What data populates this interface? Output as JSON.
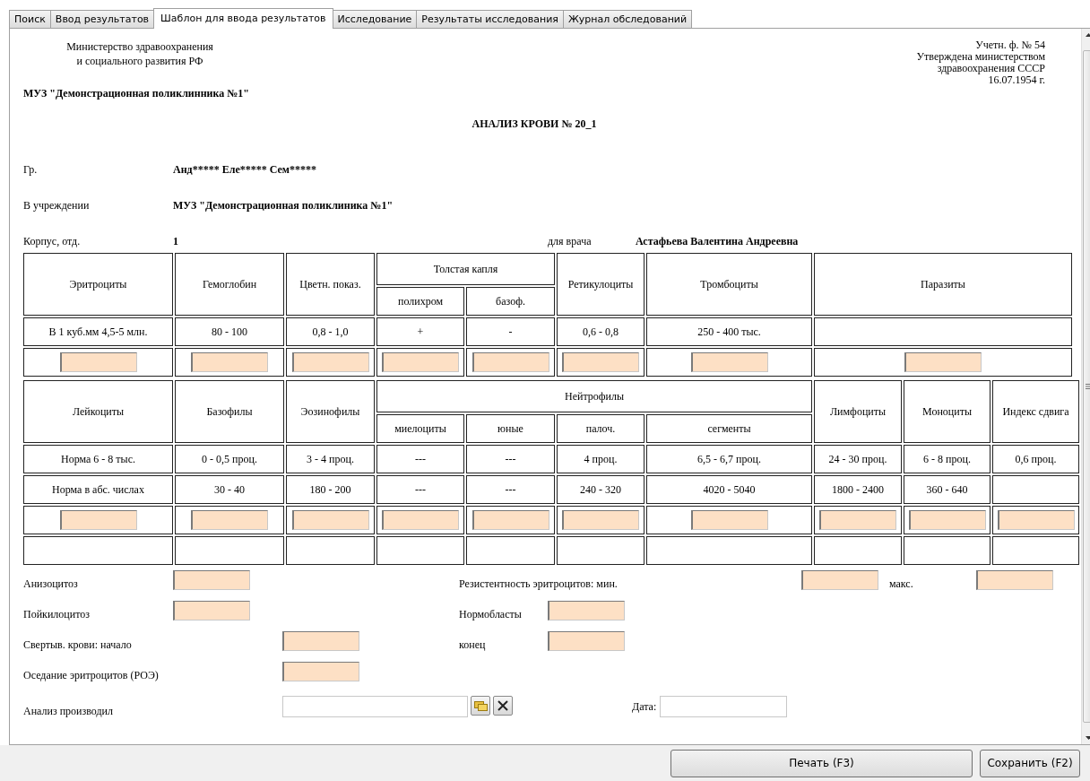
{
  "tabs": [
    {
      "label": "Поиск",
      "selected": false
    },
    {
      "label": "Ввод результатов",
      "selected": false
    },
    {
      "label": "Шаблон для ввода результатов",
      "selected": true
    },
    {
      "label": "Исследование",
      "selected": false
    },
    {
      "label": "Результаты исследования",
      "selected": false
    },
    {
      "label": "Журнал обследований",
      "selected": false
    }
  ],
  "header": {
    "ministry": [
      "Министерство здравоохранения",
      "и социального развития РФ"
    ],
    "organization": "МУЗ \"Демонстрационная поликлинника №1\"",
    "form_info": [
      "Учетн. ф. № 54",
      "Утверждена министерством",
      "здравоохранения СССР",
      "16.07.1954 г."
    ]
  },
  "title": "АНАЛИЗ КРОВИ № 20_1",
  "info": [
    {
      "label": "Гр.",
      "value": "Анд***** Еле***** Сем*****"
    },
    {
      "label": "В учреждении",
      "value": "МУЗ \"Демонстрационная поликлиника №1\""
    },
    {
      "label": "Корпус, отд.",
      "value": "1",
      "extra_label": "для врача",
      "extra_value": "Астафьева Валентина Андреевна"
    }
  ],
  "tables": [
    {
      "columns": [
        {
          "label": "Эритроциты"
        },
        {
          "label": "Гемоглобин"
        },
        {
          "label": "Цветн. показ."
        },
        {
          "label": "Толстая капля",
          "children": [
            {
              "label": "полихром"
            },
            {
              "label": "базоф."
            }
          ]
        },
        {
          "label": "Ретикулоциты"
        },
        {
          "label": "Тромбоциты"
        },
        {
          "label": "Паразиты"
        }
      ],
      "rows": [
        {
          "kind": "text",
          "cells": [
            "В 1 куб.мм 4,5-5 млн.",
            "80 - 100",
            "0,8 - 1,0",
            "+",
            "-",
            "0,6 - 0,8",
            "250 - 400 тыс.",
            null
          ]
        },
        {
          "kind": "input"
        }
      ]
    },
    {
      "columns": [
        {
          "label": "Лейкоциты"
        },
        {
          "label": "Базофилы"
        },
        {
          "label": "Эозинофилы"
        },
        {
          "label": "Нейтрофилы",
          "children": [
            {
              "label": "миелоциты"
            },
            {
              "label": "юные"
            },
            {
              "label": "палоч."
            },
            {
              "label": "сегменты"
            }
          ]
        },
        {
          "label": "Лимфоциты"
        },
        {
          "label": "Моноциты"
        },
        {
          "label": "Индекс сдвига"
        }
      ],
      "rows": [
        {
          "kind": "text",
          "cells": [
            "Норма 6 - 8 тыс.",
            "0 - 0,5 проц.",
            "3 - 4 проц.",
            "---",
            "---",
            "4 проц.",
            "6,5 - 6,7 проц.",
            "24 - 30 проц.",
            "6 - 8 проц.",
            "0,6 проц."
          ]
        },
        {
          "kind": "text",
          "cells": [
            "Норма в абс. числах",
            "30 - 40",
            "180 - 200",
            "---",
            "---",
            "240 - 320",
            "4020 - 5040",
            "1800 - 2400",
            "360 - 640",
            null
          ]
        },
        {
          "kind": "input"
        },
        {
          "kind": "blank"
        }
      ]
    }
  ],
  "measurements": [
    [
      {
        "label": "Анизоцитоз"
      },
      {
        "label": "Резистентность эритроцитов: мин."
      },
      {
        "label": "макс."
      }
    ],
    [
      {
        "label": "Пойкилоцитоз"
      },
      {
        "label": "Нормобласты"
      }
    ],
    [
      {
        "label": "Свертыв. крови: начало"
      },
      {
        "label": "конец"
      }
    ],
    [
      {
        "label": "Оседание эритроцитов (РОЭ)"
      }
    ]
  ],
  "performer": {
    "label": "Анализ производил"
  },
  "date": {
    "label": "Дата:"
  },
  "buttons": [
    {
      "label": "Печать (F3)"
    },
    {
      "label": "Сохранить (F2)"
    }
  ]
}
